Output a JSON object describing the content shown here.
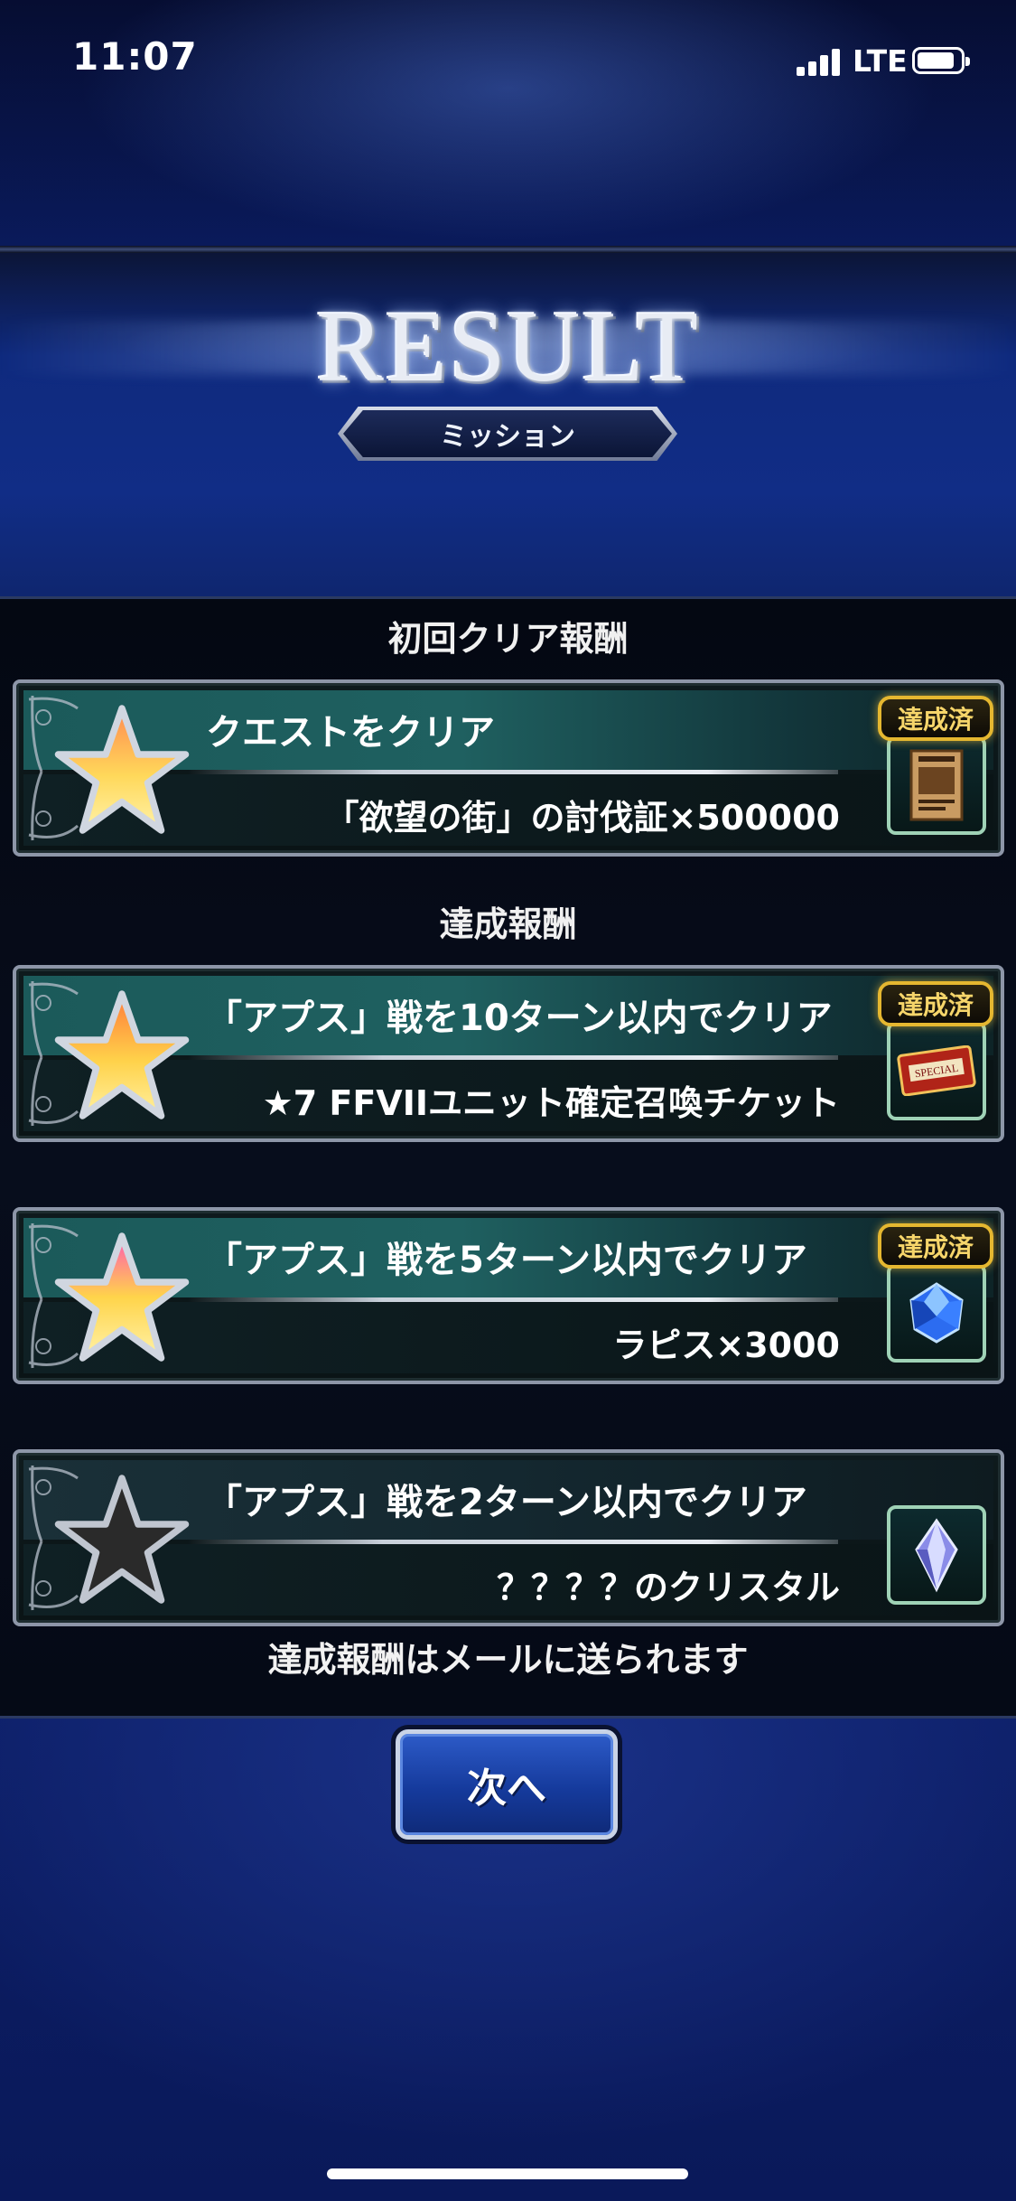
{
  "status_bar": {
    "time": "11:07",
    "network": "LTE",
    "signal_bars": 4,
    "battery_level": 0.8
  },
  "header": {
    "title": "RESULT",
    "subtitle": "ミッション"
  },
  "sections": {
    "first_clear": "初回クリア報酬",
    "achievement": "達成報酬"
  },
  "missions": [
    {
      "title": "クエストをクリア",
      "reward": "「欲望の街」の討伐証×500000",
      "status": "達成済",
      "achieved": true,
      "icon": "wanted-poster-icon"
    },
    {
      "title": "「アプス」戦を10ターン以内でクリア",
      "reward": "★7 FFVIIユニット確定召喚チケット",
      "status": "達成済",
      "achieved": true,
      "icon": "special-ticket-icon"
    },
    {
      "title": "「アプス」戦を5ターン以内でクリア",
      "reward": "ラピス×3000",
      "status": "達成済",
      "achieved": true,
      "icon": "lapis-gem-icon"
    },
    {
      "title": "「アプス」戦を2ターン以内でクリア",
      "reward": "？？？？のクリスタル",
      "status": "",
      "achieved": false,
      "icon": "crystal-icon"
    }
  ],
  "footer_note": "達成報酬はメールに送られます",
  "next_button": "次へ",
  "colors": {
    "star_gold": "#f7c63a",
    "star_inactive": "#2a2a2a",
    "badge_gold": "#e5b730",
    "button_blue": "#1e48b4"
  }
}
